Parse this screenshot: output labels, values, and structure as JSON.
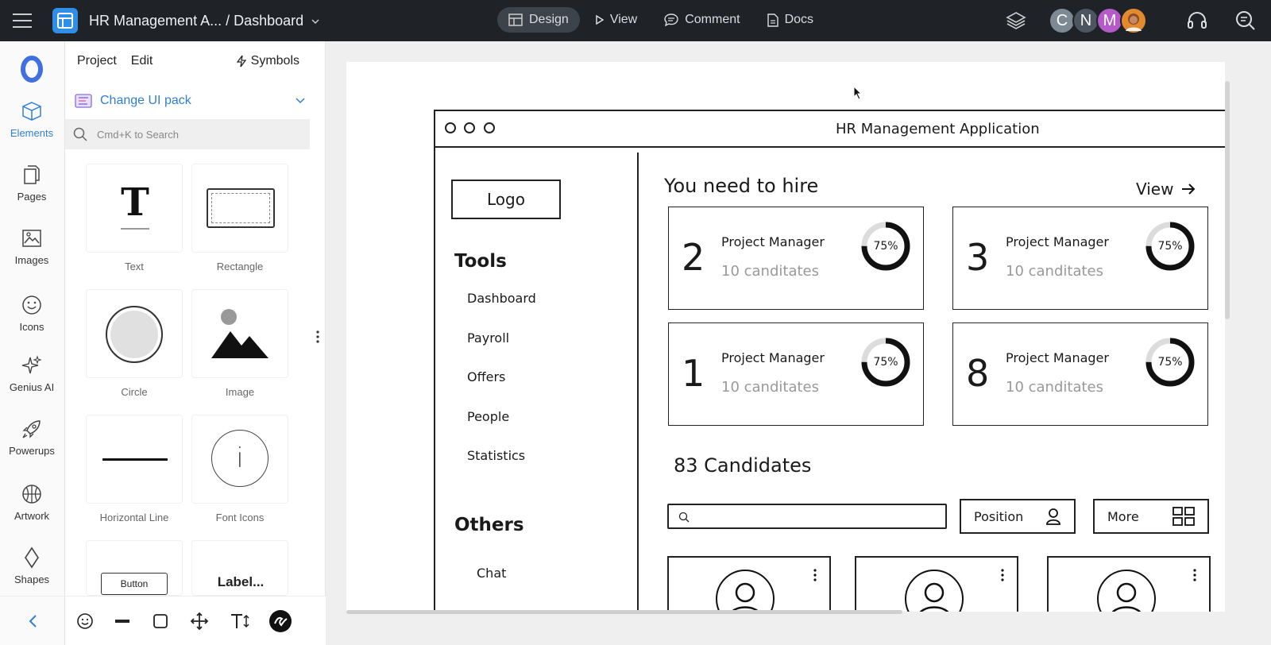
{
  "topbar": {
    "project_title": "HR Management A... / Dashboard",
    "modes": [
      {
        "label": "Design",
        "icon": "layout-icon",
        "active": true
      },
      {
        "label": "View",
        "icon": "play-icon",
        "active": false
      },
      {
        "label": "Comment",
        "icon": "comment-icon",
        "active": false
      },
      {
        "label": "Docs",
        "icon": "document-icon",
        "active": false
      }
    ],
    "avatars": [
      {
        "initial": "C",
        "color": "#7d8a94"
      },
      {
        "initial": "N",
        "color": "#5a6570"
      },
      {
        "initial": "M",
        "color": "#b45bc9"
      }
    ]
  },
  "rail": {
    "items": [
      {
        "label": "Elements",
        "icon": "cube-icon",
        "active": true
      },
      {
        "label": "Pages",
        "icon": "pages-icon",
        "active": false
      },
      {
        "label": "Images",
        "icon": "image-icon",
        "active": false
      },
      {
        "label": "Icons",
        "icon": "smiley-icon",
        "active": false
      },
      {
        "label": "Genius AI",
        "icon": "sparkle-icon",
        "active": false
      },
      {
        "label": "Powerups",
        "icon": "rocket-icon",
        "active": false
      },
      {
        "label": "Artwork",
        "icon": "basketball-icon",
        "active": false
      },
      {
        "label": "Shapes",
        "icon": "diamond-icon",
        "active": false
      }
    ]
  },
  "panel": {
    "menu": [
      "Project",
      "Edit"
    ],
    "symbols_label": "Symbols",
    "ui_pack_label": "Change UI pack",
    "search_placeholder": "Cmd+K to Search",
    "elements": [
      {
        "label": "Text",
        "glyph": "T"
      },
      {
        "label": "Rectangle"
      },
      {
        "label": "Circle"
      },
      {
        "label": "Image"
      },
      {
        "label": "Horizontal Line"
      },
      {
        "label": "Font Icons",
        "glyph": "i"
      },
      {
        "label": "",
        "glyph": "Button"
      },
      {
        "label": "",
        "glyph": "Label..."
      }
    ]
  },
  "mockup": {
    "window_title": "HR Management Application",
    "logo": "Logo",
    "tools_heading": "Tools",
    "tools": [
      "Dashboard",
      "Payroll",
      "Offers",
      "People",
      "Statistics"
    ],
    "others_heading": "Others",
    "others": [
      "Chat"
    ],
    "hire_title": "You need to hire",
    "view_label": "View",
    "cards": [
      {
        "count": "2",
        "role": "Project Manager",
        "sub": "10 canditates",
        "pct_label": "75%",
        "pct": 0.75
      },
      {
        "count": "3",
        "role": "Project Manager",
        "sub": "10 canditates",
        "pct_label": "75%",
        "pct": 0.75
      },
      {
        "count": "1",
        "role": "Project Manager",
        "sub": "10 canditates",
        "pct_label": "75%",
        "pct": 0.75
      },
      {
        "count": "8",
        "role": "Project Manager",
        "sub": "10 canditates",
        "pct_label": "75%",
        "pct": 0.75
      }
    ],
    "candidates_title": "83 Candidates",
    "position_label": "Position",
    "more_label": "More"
  }
}
